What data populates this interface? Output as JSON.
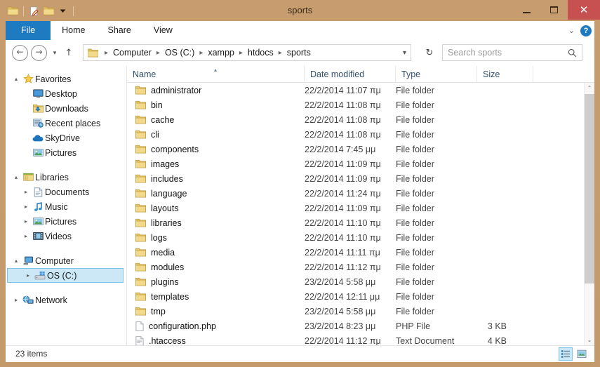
{
  "window": {
    "title": "sports",
    "quick_access": [
      "folder-icon",
      "new-folder-icon",
      "folder-properties-icon",
      "customize-dropdown-icon"
    ],
    "controls": {
      "minimize": "minimize-icon",
      "maximize": "maximize-icon",
      "close": "close-icon"
    },
    "close_glyph": "✕"
  },
  "ribbon": {
    "tabs": [
      {
        "label": "File",
        "active": true
      },
      {
        "label": "Home",
        "active": false
      },
      {
        "label": "Share",
        "active": false
      },
      {
        "label": "View",
        "active": false
      }
    ],
    "collapse_glyph": "⌄",
    "help_glyph": "?"
  },
  "address": {
    "back_glyph": "←",
    "forward_glyph": "→",
    "history_glyph": "▾",
    "up_glyph": "↑",
    "separator": "▸",
    "dropdown_glyph": "▾",
    "refresh_glyph": "↻",
    "breadcrumb": [
      "Computer",
      "OS (C:)",
      "xampp",
      "htdocs",
      "sports"
    ]
  },
  "search": {
    "placeholder": "Search sports",
    "icon": "search-icon"
  },
  "sidebar": {
    "groups": [
      {
        "header": {
          "label": "Favorites",
          "icon": "star-icon",
          "expander": "▴"
        },
        "items": [
          {
            "label": "Desktop",
            "icon": "desktop-icon",
            "expander": ""
          },
          {
            "label": "Downloads",
            "icon": "downloads-icon",
            "expander": ""
          },
          {
            "label": "Recent places",
            "icon": "recent-places-icon",
            "expander": ""
          },
          {
            "label": "SkyDrive",
            "icon": "skydrive-icon",
            "expander": ""
          },
          {
            "label": "Pictures",
            "icon": "pictures-icon",
            "expander": ""
          }
        ]
      },
      {
        "header": {
          "label": "Libraries",
          "icon": "libraries-icon",
          "expander": "▴"
        },
        "items": [
          {
            "label": "Documents",
            "icon": "documents-icon",
            "expander": "▸"
          },
          {
            "label": "Music",
            "icon": "music-icon",
            "expander": "▸"
          },
          {
            "label": "Pictures",
            "icon": "pictures-icon",
            "expander": "▸"
          },
          {
            "label": "Videos",
            "icon": "videos-icon",
            "expander": "▸"
          }
        ]
      },
      {
        "header": {
          "label": "Computer",
          "icon": "computer-icon",
          "expander": "▴"
        },
        "items": [
          {
            "label": "OS (C:)",
            "icon": "drive-icon",
            "expander": "▸",
            "selected": true
          }
        ]
      },
      {
        "header": {
          "label": "Network",
          "icon": "network-icon",
          "expander": "▸"
        },
        "items": []
      }
    ]
  },
  "file_list": {
    "columns": [
      {
        "label": "Name",
        "sorted": "asc",
        "sort_glyph": "▴"
      },
      {
        "label": "Date modified",
        "sorted": ""
      },
      {
        "label": "Type",
        "sorted": ""
      },
      {
        "label": "Size",
        "sorted": ""
      }
    ],
    "rows": [
      {
        "name": "administrator",
        "date": "22/2/2014 11:07 πμ",
        "type": "File folder",
        "size": "",
        "icon": "folder-icon"
      },
      {
        "name": "bin",
        "date": "22/2/2014 11:08 πμ",
        "type": "File folder",
        "size": "",
        "icon": "folder-icon"
      },
      {
        "name": "cache",
        "date": "22/2/2014 11:08 πμ",
        "type": "File folder",
        "size": "",
        "icon": "folder-icon"
      },
      {
        "name": "cli",
        "date": "22/2/2014 11:08 πμ",
        "type": "File folder",
        "size": "",
        "icon": "folder-icon"
      },
      {
        "name": "components",
        "date": "22/2/2014 7:45 μμ",
        "type": "File folder",
        "size": "",
        "icon": "folder-icon"
      },
      {
        "name": "images",
        "date": "22/2/2014 11:09 πμ",
        "type": "File folder",
        "size": "",
        "icon": "folder-icon"
      },
      {
        "name": "includes",
        "date": "22/2/2014 11:09 πμ",
        "type": "File folder",
        "size": "",
        "icon": "folder-icon"
      },
      {
        "name": "language",
        "date": "22/2/2014 11:24 πμ",
        "type": "File folder",
        "size": "",
        "icon": "folder-icon"
      },
      {
        "name": "layouts",
        "date": "22/2/2014 11:09 πμ",
        "type": "File folder",
        "size": "",
        "icon": "folder-icon"
      },
      {
        "name": "libraries",
        "date": "22/2/2014 11:10 πμ",
        "type": "File folder",
        "size": "",
        "icon": "folder-icon"
      },
      {
        "name": "logs",
        "date": "22/2/2014 11:10 πμ",
        "type": "File folder",
        "size": "",
        "icon": "folder-icon"
      },
      {
        "name": "media",
        "date": "22/2/2014 11:11 πμ",
        "type": "File folder",
        "size": "",
        "icon": "folder-icon"
      },
      {
        "name": "modules",
        "date": "22/2/2014 11:12 πμ",
        "type": "File folder",
        "size": "",
        "icon": "folder-icon"
      },
      {
        "name": "plugins",
        "date": "23/2/2014 5:58 μμ",
        "type": "File folder",
        "size": "",
        "icon": "folder-icon"
      },
      {
        "name": "templates",
        "date": "22/2/2014 12:11 μμ",
        "type": "File folder",
        "size": "",
        "icon": "folder-icon"
      },
      {
        "name": "tmp",
        "date": "23/2/2014 5:58 μμ",
        "type": "File folder",
        "size": "",
        "icon": "folder-icon"
      },
      {
        "name": "configuration.php",
        "date": "23/2/2014 8:23 μμ",
        "type": "PHP File",
        "size": "3 KB",
        "icon": "file-icon"
      },
      {
        "name": ".htaccess",
        "date": "22/2/2014 11:12 πμ",
        "type": "Text Document",
        "size": "4 KB",
        "icon": "text-file-icon"
      }
    ],
    "scrollbar": {
      "up_glyph": "⌃",
      "down_glyph": "⌄"
    }
  },
  "status": {
    "item_count": "23 items",
    "views": [
      {
        "name": "details-view",
        "active": true
      },
      {
        "name": "large-icons-view",
        "active": false
      }
    ]
  },
  "colors": {
    "frame": "#c49a6c",
    "accent": "#1f7bc1",
    "close": "#c75050",
    "selection": "#cce8f6",
    "selection_border": "#7ec5e8",
    "folder": "#ecc56a"
  }
}
